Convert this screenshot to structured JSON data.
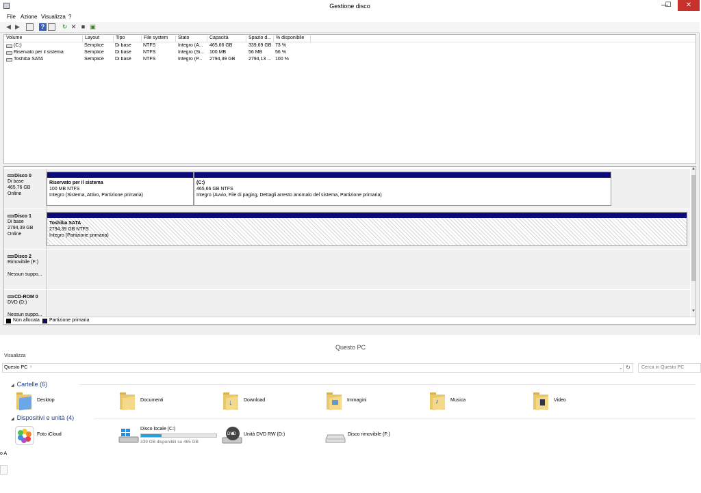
{
  "disk_mgmt": {
    "title": "Gestione disco",
    "window_buttons": {
      "minimize": "—",
      "maximize": "☐",
      "close": "✕"
    },
    "menu": [
      "File",
      "Azione",
      "Visualizza",
      "?"
    ],
    "volume_columns": [
      "Volume",
      "Layout",
      "Tipo",
      "File system",
      "Stato",
      "Capacità",
      "Spazio d...",
      "% disponibile"
    ],
    "volumes": [
      {
        "volume": "(C:)",
        "layout": "Semplice",
        "tipo": "Di base",
        "fs": "NTFS",
        "stato": "Integro (A...",
        "capacita": "465,66 GB",
        "spazio": "339,69 GB",
        "disp": "73 %"
      },
      {
        "volume": "Riservato per il sistema",
        "layout": "Semplice",
        "tipo": "Di base",
        "fs": "NTFS",
        "stato": "Integro (Si...",
        "capacita": "100 MB",
        "spazio": "56 MB",
        "disp": "56 %"
      },
      {
        "volume": "Toshiba SATA",
        "layout": "Semplice",
        "tipo": "Di base",
        "fs": "NTFS",
        "stato": "Integro (P...",
        "capacita": "2794,39 GB",
        "spazio": "2794,13 ...",
        "disp": "100 %"
      }
    ],
    "disks": [
      {
        "name": "Disco 0",
        "type": "Di base",
        "size": "465,76 GB",
        "status": "Online",
        "partitions": [
          {
            "name": "Riservato per il sistema",
            "size": "100 MB NTFS",
            "status": "Integro (Sistema, Attivo, Partizione primaria)"
          },
          {
            "name": "(C:)",
            "size": "465,66 GB NTFS",
            "status": "Integro (Avvio, File di paging, Dettagli arresto anomalo del sistema, Partizione primaria)"
          }
        ]
      },
      {
        "name": "Disco 1",
        "type": "Di base",
        "size": "2794,39 GB",
        "status": "Online",
        "partitions": [
          {
            "name": "Toshiba SATA",
            "size": "2794,39 GB NTFS",
            "status": "Integro (Partizione primaria)"
          }
        ]
      },
      {
        "name": "Disco 2",
        "type": "Rimovibile (F:)",
        "size": "",
        "status": "Nessun suppo..."
      },
      {
        "name": "CD-ROM 0",
        "type": "DVD (D:)",
        "size": "",
        "status": "Nessun suppo..."
      }
    ],
    "legend": [
      {
        "label": "Non allocata",
        "color": "#000000"
      },
      {
        "label": "Partizione primaria",
        "color": "#0a0a78"
      }
    ]
  },
  "this_pc": {
    "title": "Questo PC",
    "ribbon_tab": "Visualizza",
    "address": "Questo PC",
    "address_sep": "›",
    "search_placeholder": "Cerca in Questo PC",
    "folders_header": "Cartelle (6)",
    "folders": [
      "Desktop",
      "Documenti",
      "Download",
      "Immagini",
      "Musica",
      "Video"
    ],
    "devices_header": "Dispositivi e unità (4)",
    "devices": [
      {
        "name": "Foto iCloud",
        "icon": "icloud-photos-icon"
      },
      {
        "name": "Disco locale (C:)",
        "icon": "windows-drive-icon",
        "sub": "339 GB disponibili su 465 GB",
        "used_fraction": 0.27
      },
      {
        "name": "Unità DVD RW (D:)",
        "icon": "dvd-drive-icon"
      },
      {
        "name": "Disco rimovibile (F:)",
        "icon": "removable-drive-icon"
      }
    ],
    "left_stub": "o A"
  }
}
